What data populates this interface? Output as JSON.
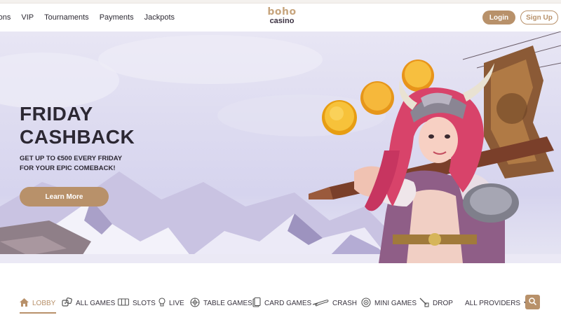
{
  "header": {
    "nav": [
      "otions",
      "VIP",
      "Tournaments",
      "Payments",
      "Jackpots"
    ],
    "logo_top": "boho",
    "logo_bottom": "casino",
    "login_label": "Login",
    "signup_label": "Sign Up"
  },
  "hero": {
    "title_line1": "FRIDAY",
    "title_line2": "CASHBACK",
    "subtitle_line1": "GET UP TO €500 EVERY FRIDAY",
    "subtitle_line2": "FOR YOUR EPIC COMEBACK!",
    "cta_label": "Learn More"
  },
  "categories": [
    {
      "label": "LOBBY",
      "icon": "home-icon"
    },
    {
      "label": "ALL GAMES",
      "icon": "dice-icon"
    },
    {
      "label": "SLOTS",
      "icon": "slot-machine-icon"
    },
    {
      "label": "LIVE",
      "icon": "lightbulb-icon"
    },
    {
      "label": "TABLE GAMES",
      "icon": "roulette-icon"
    },
    {
      "label": "CARD GAMES",
      "icon": "cards-icon"
    },
    {
      "label": "CRASH",
      "icon": "airplane-icon"
    },
    {
      "label": "MINI GAMES",
      "icon": "mini-games-icon"
    },
    {
      "label": "DROP",
      "icon": "drop-icon"
    }
  ],
  "providers_label": "ALL PROVIDERS",
  "colors": {
    "accent": "#b8916a",
    "text_dark": "#2c2833",
    "hero_bg": "#dcdaf0"
  }
}
